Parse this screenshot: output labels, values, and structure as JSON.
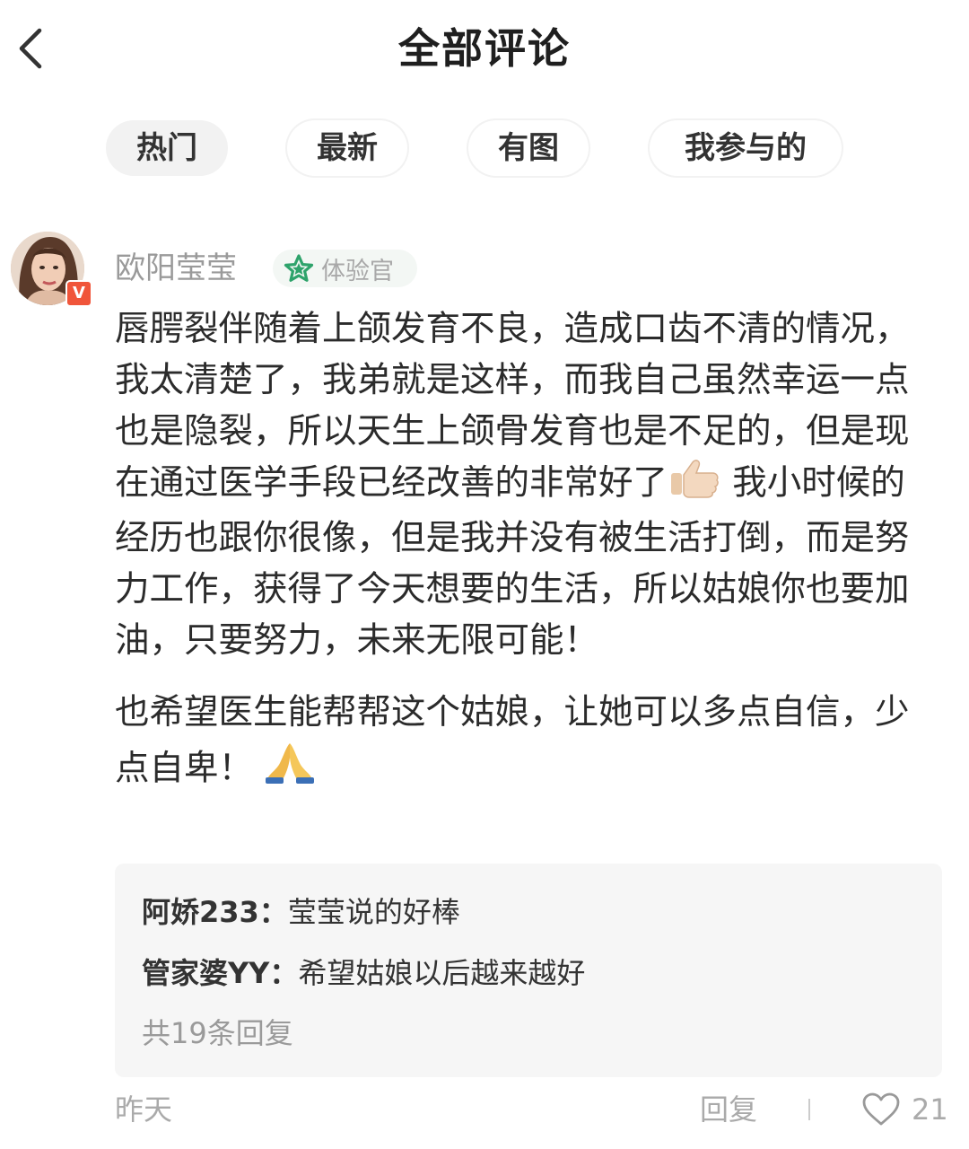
{
  "header": {
    "title": "全部评论",
    "back_icon": "chevron-left-icon"
  },
  "tabs": [
    {
      "label": "热门",
      "active": true
    },
    {
      "label": "最新",
      "active": false
    },
    {
      "label": "有图",
      "active": false
    },
    {
      "label": "我参与的",
      "active": false
    }
  ],
  "comment": {
    "username": "欧阳莹莹",
    "verified_badge": "V",
    "badge_label": "体验官",
    "badge_icon": "star-icon",
    "paragraph1_part1": "唇腭裂伴随着上颌发育不良，造成口齿不清的情况，我太清楚了，我弟就是这样，而我自己虽然幸运一点也是隐裂，所以天生上颌骨发育也是不足的，但是现在通过医学手段已经改善的非常好了",
    "paragraph1_emoji": "thumbs-up-icon",
    "paragraph1_part2": " 我小时候的经历也跟你很像，但是我并没有被生活打倒，而是努力工作，获得了今天想要的生活，所以姑娘你也要加油，只要努力，未来无限可能！",
    "paragraph2_text": "也希望医生能帮帮这个姑娘，让她可以多点自信，少点自卑！ ",
    "paragraph2_emoji": "folded-hands-icon",
    "replies": [
      {
        "name": "阿娇233：",
        "text": "莹莹说的好棒"
      },
      {
        "name": "管家婆YY：",
        "text": "希望姑娘以后越来越好"
      }
    ],
    "reply_count_text": "共19条回复",
    "time": "昨天",
    "reply_button": "回复",
    "like_count": "21",
    "colors": {
      "badge_star": "#2ea36b",
      "verified": "#f0553a",
      "secondary_text": "#aaaaaa"
    }
  }
}
